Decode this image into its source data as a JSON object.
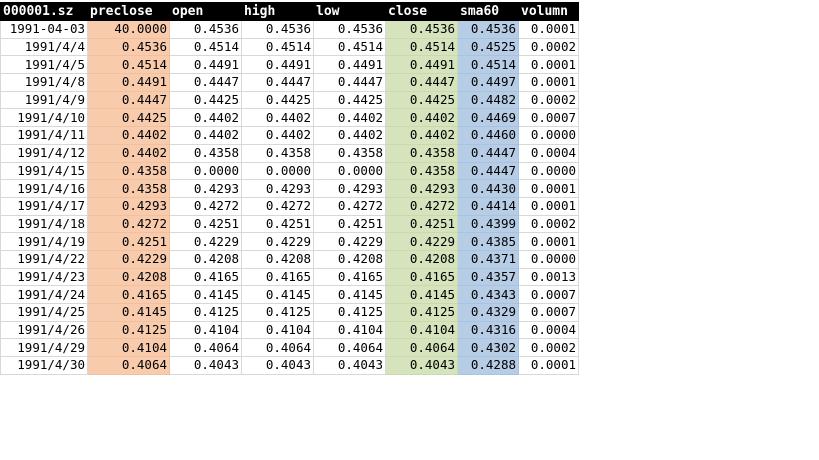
{
  "sheet": {
    "headers": {
      "date": "000001.sz",
      "preclose": "preclose",
      "open": "open",
      "high": "high",
      "low": "low",
      "close": "close",
      "sma60": "sma60",
      "volumn": "volumn"
    },
    "column_colors": {
      "header_bg": "#000000",
      "header_text": "#ffffff",
      "preclose": "#f8cbad",
      "close": "#d5e4bc",
      "sma60": "#b7cde6"
    },
    "rows": [
      [
        "1991-04-03",
        "40.0000",
        "0.4536",
        "0.4536",
        "0.4536",
        "0.4536",
        "0.4536",
        "0.0001"
      ],
      [
        "1991/4/4",
        "0.4536",
        "0.4514",
        "0.4514",
        "0.4514",
        "0.4514",
        "0.4525",
        "0.0002"
      ],
      [
        "1991/4/5",
        "0.4514",
        "0.4491",
        "0.4491",
        "0.4491",
        "0.4491",
        "0.4514",
        "0.0001"
      ],
      [
        "1991/4/8",
        "0.4491",
        "0.4447",
        "0.4447",
        "0.4447",
        "0.4447",
        "0.4497",
        "0.0001"
      ],
      [
        "1991/4/9",
        "0.4447",
        "0.4425",
        "0.4425",
        "0.4425",
        "0.4425",
        "0.4482",
        "0.0002"
      ],
      [
        "1991/4/10",
        "0.4425",
        "0.4402",
        "0.4402",
        "0.4402",
        "0.4402",
        "0.4469",
        "0.0007"
      ],
      [
        "1991/4/11",
        "0.4402",
        "0.4402",
        "0.4402",
        "0.4402",
        "0.4402",
        "0.4460",
        "0.0000"
      ],
      [
        "1991/4/12",
        "0.4402",
        "0.4358",
        "0.4358",
        "0.4358",
        "0.4358",
        "0.4447",
        "0.0004"
      ],
      [
        "1991/4/15",
        "0.4358",
        "0.0000",
        "0.0000",
        "0.0000",
        "0.4358",
        "0.4447",
        "0.0000"
      ],
      [
        "1991/4/16",
        "0.4358",
        "0.4293",
        "0.4293",
        "0.4293",
        "0.4293",
        "0.4430",
        "0.0001"
      ],
      [
        "1991/4/17",
        "0.4293",
        "0.4272",
        "0.4272",
        "0.4272",
        "0.4272",
        "0.4414",
        "0.0001"
      ],
      [
        "1991/4/18",
        "0.4272",
        "0.4251",
        "0.4251",
        "0.4251",
        "0.4251",
        "0.4399",
        "0.0002"
      ],
      [
        "1991/4/19",
        "0.4251",
        "0.4229",
        "0.4229",
        "0.4229",
        "0.4229",
        "0.4385",
        "0.0001"
      ],
      [
        "1991/4/22",
        "0.4229",
        "0.4208",
        "0.4208",
        "0.4208",
        "0.4208",
        "0.4371",
        "0.0000"
      ],
      [
        "1991/4/23",
        "0.4208",
        "0.4165",
        "0.4165",
        "0.4165",
        "0.4165",
        "0.4357",
        "0.0013"
      ],
      [
        "1991/4/24",
        "0.4165",
        "0.4145",
        "0.4145",
        "0.4145",
        "0.4145",
        "0.4343",
        "0.0007"
      ],
      [
        "1991/4/25",
        "0.4145",
        "0.4125",
        "0.4125",
        "0.4125",
        "0.4125",
        "0.4329",
        "0.0007"
      ],
      [
        "1991/4/26",
        "0.4125",
        "0.4104",
        "0.4104",
        "0.4104",
        "0.4104",
        "0.4316",
        "0.0004"
      ],
      [
        "1991/4/29",
        "0.4104",
        "0.4064",
        "0.4064",
        "0.4064",
        "0.4064",
        "0.4302",
        "0.0002"
      ],
      [
        "1991/4/30",
        "0.4064",
        "0.4043",
        "0.4043",
        "0.4043",
        "0.4043",
        "0.4288",
        "0.0001"
      ]
    ]
  }
}
